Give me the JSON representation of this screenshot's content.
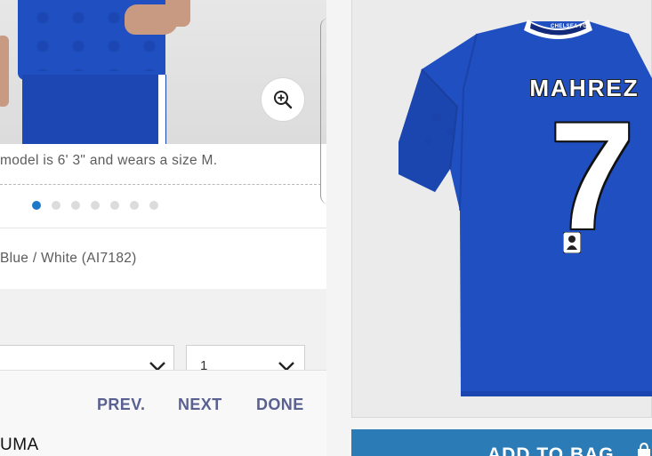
{
  "product_info": {
    "model_caption": "model is 6' 3\" and wears a size M.",
    "color_code": "Blue / White (AI7182)",
    "gallery_total": 7,
    "gallery_active_index": 0
  },
  "selectors": {
    "size_value": "",
    "quantity_value": "1"
  },
  "picker_toolbar": {
    "prev_label": "PREV.",
    "next_label": "NEXT",
    "done_label": "DONE"
  },
  "brand_partial": "UMA",
  "jersey": {
    "player_name": "MAHREZ",
    "player_number": "7",
    "collar_text": "CHELSEA FC"
  },
  "add_to_bag": {
    "label": "ADD TO BAG"
  },
  "colors": {
    "jersey_blue": "#1f4fc0",
    "toolbar_text": "#5a6191",
    "add_bag": "#2a7bb6",
    "active_dot": "#1e78c8"
  },
  "icons": [
    "zoom-in-icon",
    "chevron-down-icon",
    "bag-icon",
    "premier-league-badge-icon"
  ]
}
